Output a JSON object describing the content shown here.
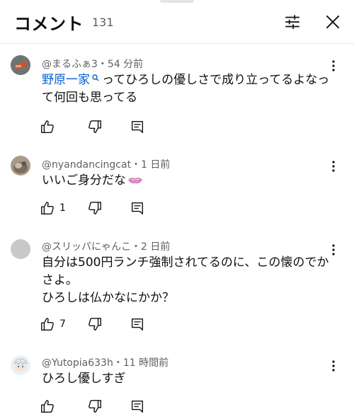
{
  "header": {
    "title": "コメント",
    "count": "131"
  },
  "comments": [
    {
      "author": "@まるふぁ3・54 分前",
      "link_text": "野原一家",
      "line1_rest": "ってひろしの優しさで成り立ってるよなっ",
      "line2": "て何回も思ってる",
      "likes": ""
    },
    {
      "author": "@nyandancingcat・1 日前",
      "text": "いいご身分だな",
      "emoji": "smiling-lips-emoji",
      "likes": "1"
    },
    {
      "author": "@スリッパにゃんこ・2 日前",
      "line1": "自分は500円ランチ強制されてるのに、この懐のでか",
      "line2": "さよ。",
      "line3": "ひろしは仏かなにかか？",
      "likes": "7"
    },
    {
      "author": "@Yutopia633h・11 時間前",
      "text": "ひろし優しすぎ",
      "likes": ""
    }
  ],
  "icons": {
    "filter": "filter-sliders-icon",
    "close": "close-icon",
    "like": "thumbs-up-icon",
    "dislike": "thumbs-down-icon",
    "reply": "reply-comment-icon",
    "more": "more-vertical-icon",
    "search_link": "search-link-icon"
  },
  "colors": {
    "link": "#065fd4",
    "secondary_text": "#606060",
    "divider": "#e5e5e5"
  }
}
